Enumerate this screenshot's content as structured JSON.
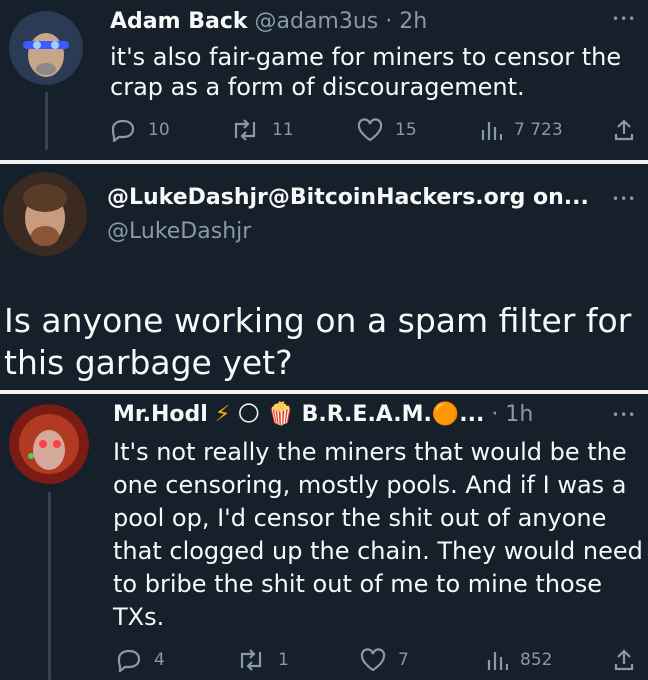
{
  "tweet1": {
    "display_name": "Adam Back",
    "handle": "@adam3us",
    "time": "2h",
    "text_lines": [
      "it's also fair-game for miners to censor the",
      "crap as a form of discouragement."
    ],
    "replies": "10",
    "retweets": "11",
    "likes": "15",
    "views": "7 723"
  },
  "tweet2": {
    "display_name": "@LukeDashjr@BitcoinHackers.org on...",
    "handle": "@LukeDashjr",
    "text_lines": [
      "Is anyone working on a spam filter for",
      "this garbage yet?"
    ]
  },
  "tweet3": {
    "display_name": "Mr.Hodl",
    "name_suffix": "B.R.E.A.M.",
    "ellipsis": "...",
    "time": "1h",
    "text_lines": [
      "It's not really the miners that would be the",
      "one censoring, mostly pools. And if I was a",
      "pool op, I'd censor the shit out of anyone",
      "that clogged up the chain. They would need",
      "to bribe the shit out of me to mine those",
      "TXs."
    ],
    "replies": "4",
    "retweets": "1",
    "likes": "7",
    "views": "852"
  },
  "more_glyph": "•••",
  "dot_separator": "·",
  "emoji": {
    "lightning": "⚡",
    "moon": "🌕",
    "popcorn": "🍿",
    "orange_circle": "🟠"
  },
  "colors": {
    "background": "#15202b",
    "muted": "#8b98a5",
    "separator": "#f0f0f0",
    "lightning": "#f4b400"
  }
}
